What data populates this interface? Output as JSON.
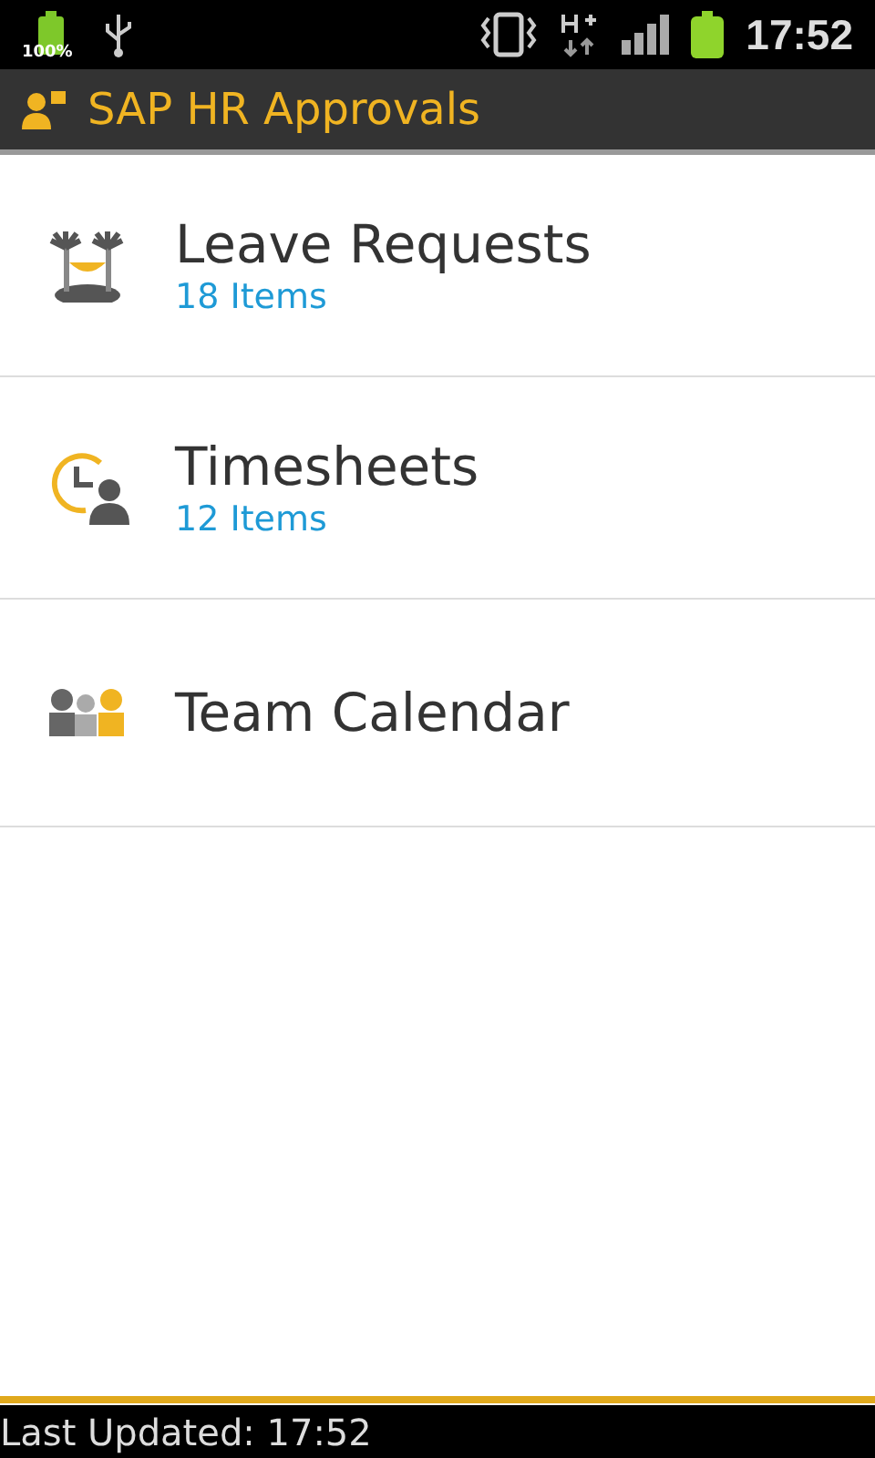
{
  "status_bar": {
    "battery_percent": "100%",
    "time": "17:52"
  },
  "app_bar": {
    "title": "SAP HR Approvals"
  },
  "items": [
    {
      "kind": "leave",
      "title": "Leave Requests",
      "count": "18 Items"
    },
    {
      "kind": "timesheet",
      "title": "Timesheets",
      "count": "12 Items"
    },
    {
      "kind": "calendar",
      "title": "Team Calendar"
    }
  ],
  "footer": {
    "text": "Last Updated: 17:52"
  }
}
